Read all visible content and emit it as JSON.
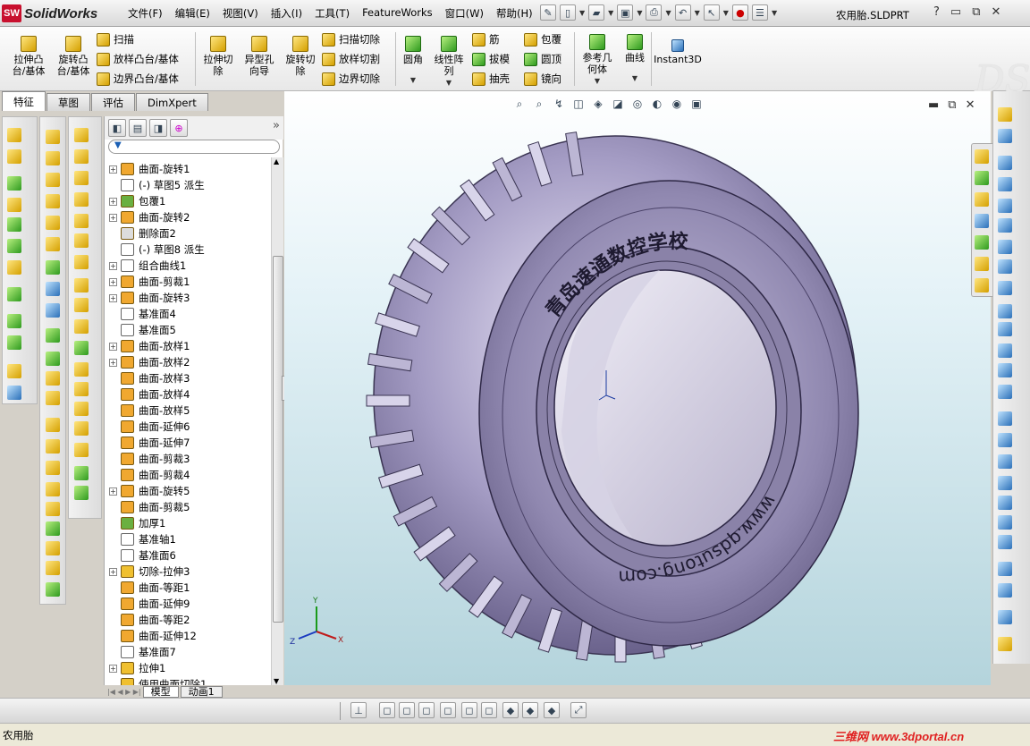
{
  "app": {
    "logo_text": "SolidWorks",
    "logo_badge": "SW"
  },
  "menu": [
    "文件(F)",
    "编辑(E)",
    "视图(V)",
    "插入(I)",
    "工具(T)",
    "FeatureWorks",
    "窗口(W)",
    "帮助(H)"
  ],
  "document_title": "农用胎.SLDPRT",
  "window_controls": {
    "help": "?",
    "min": "▭",
    "restore": "⧉",
    "close": "✕"
  },
  "command_manager": {
    "big_buttons": [
      {
        "label": "拉伸凸\n台/基体"
      },
      {
        "label": "旋转凸\n台/基体"
      }
    ],
    "stack1": [
      "扫描",
      "放样凸台/基体",
      "边界凸台/基体"
    ],
    "big_buttons2": [
      {
        "label": "拉伸切\n除"
      },
      {
        "label": "异型孔\n向导"
      },
      {
        "label": "旋转切\n除"
      }
    ],
    "stack2": [
      "扫描切除",
      "放样切割",
      "边界切除"
    ],
    "big_buttons3": [
      {
        "label": "圆角"
      },
      {
        "label": "线性阵\n列"
      }
    ],
    "stack3": [
      "筋",
      "拔模",
      "抽壳"
    ],
    "stack4": [
      "包覆",
      "圆顶",
      "镜向"
    ],
    "big_buttons4": [
      {
        "label": "参考几\n何体"
      },
      {
        "label": "曲线"
      },
      {
        "label": "Instant3D"
      }
    ]
  },
  "tabs": [
    "特征",
    "草图",
    "评估",
    "DimXpert"
  ],
  "tree_items": [
    {
      "label": "曲面-旋转1",
      "expand": true,
      "icon": "revolve-surface-icon",
      "color": "#f0a830"
    },
    {
      "label": "(-) 草图5 派生",
      "expand": false,
      "icon": "sketch-icon",
      "color": "#ffffff",
      "indent": 1
    },
    {
      "label": "包覆1",
      "expand": true,
      "icon": "wrap-icon",
      "color": "#6ab040"
    },
    {
      "label": "曲面-旋转2",
      "expand": true,
      "icon": "revolve-surface-icon",
      "color": "#f0a830"
    },
    {
      "label": "删除面2",
      "expand": false,
      "icon": "delete-face-icon",
      "color": "#dddddd"
    },
    {
      "label": "(-) 草图8 派生",
      "expand": false,
      "icon": "sketch-icon",
      "color": "#ffffff",
      "indent": 1
    },
    {
      "label": "组合曲线1",
      "expand": true,
      "icon": "composite-curve-icon",
      "color": "#ffffff"
    },
    {
      "label": "曲面-剪裁1",
      "expand": true,
      "icon": "trim-surface-icon",
      "color": "#f0a830"
    },
    {
      "label": "曲面-旋转3",
      "expand": true,
      "icon": "revolve-surface-icon",
      "color": "#f0a830"
    },
    {
      "label": "基准面4",
      "expand": false,
      "icon": "plane-icon",
      "color": "#ffffff"
    },
    {
      "label": "基准面5",
      "expand": false,
      "icon": "plane-icon",
      "color": "#ffffff"
    },
    {
      "label": "曲面-放样1",
      "expand": true,
      "icon": "loft-surface-icon",
      "color": "#f0a830"
    },
    {
      "label": "曲面-放样2",
      "expand": true,
      "icon": "loft-surface-icon",
      "color": "#f0a830"
    },
    {
      "label": "曲面-放样3",
      "expand": false,
      "icon": "loft-surface-icon",
      "color": "#f0a830"
    },
    {
      "label": "曲面-放样4",
      "expand": false,
      "icon": "loft-surface-icon",
      "color": "#f0a830"
    },
    {
      "label": "曲面-放样5",
      "expand": false,
      "icon": "loft-surface-icon",
      "color": "#f0a830"
    },
    {
      "label": "曲面-延伸6",
      "expand": false,
      "icon": "extend-surface-icon",
      "color": "#f0a830"
    },
    {
      "label": "曲面-延伸7",
      "expand": false,
      "icon": "extend-surface-icon",
      "color": "#f0a830"
    },
    {
      "label": "曲面-剪裁3",
      "expand": false,
      "icon": "trim-surface-icon",
      "color": "#f0a830"
    },
    {
      "label": "曲面-剪裁4",
      "expand": false,
      "icon": "trim-surface-icon",
      "color": "#f0a830"
    },
    {
      "label": "曲面-旋转5",
      "expand": true,
      "icon": "revolve-surface-icon",
      "color": "#f0a830"
    },
    {
      "label": "曲面-剪裁5",
      "expand": false,
      "icon": "trim-surface-icon",
      "color": "#f0a830"
    },
    {
      "label": "加厚1",
      "expand": false,
      "icon": "thicken-icon",
      "color": "#6ab040"
    },
    {
      "label": "基准轴1",
      "expand": false,
      "icon": "axis-icon",
      "color": "#ffffff"
    },
    {
      "label": "基准面6",
      "expand": false,
      "icon": "plane-icon",
      "color": "#ffffff"
    },
    {
      "label": "切除-拉伸3",
      "expand": true,
      "icon": "cut-extrude-icon",
      "color": "#f0c030"
    },
    {
      "label": "曲面-等距1",
      "expand": false,
      "icon": "offset-surface-icon",
      "color": "#f0a830"
    },
    {
      "label": "曲面-延伸9",
      "expand": false,
      "icon": "extend-surface-icon",
      "color": "#f0a830"
    },
    {
      "label": "曲面-等距2",
      "expand": false,
      "icon": "offset-surface-icon",
      "color": "#f0a830"
    },
    {
      "label": "曲面-延伸12",
      "expand": false,
      "icon": "extend-surface-icon",
      "color": "#f0a830"
    },
    {
      "label": "基准面7",
      "expand": false,
      "icon": "plane-icon",
      "color": "#ffffff"
    },
    {
      "label": "拉伸1",
      "expand": true,
      "icon": "extrude-icon",
      "color": "#f0c030"
    },
    {
      "label": "使用曲面切除1",
      "expand": false,
      "icon": "surface-cut-icon",
      "color": "#f0c030"
    }
  ],
  "bottom_tabs": [
    "模型",
    "动画1"
  ],
  "model": {
    "tire_text_top": "青岛速通数控学校",
    "tire_text_bottom": "www.qdsutong.com",
    "tire_color": "#9a92b8"
  },
  "status_text": "农用胎",
  "watermark": "三维网 www.3dportal.cn"
}
